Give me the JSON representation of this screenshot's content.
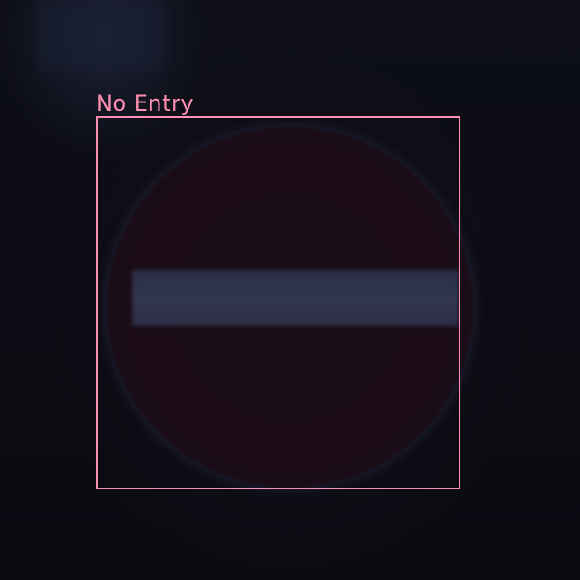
{
  "detection": {
    "label": "No Entry",
    "box_color": "#ff8fb0"
  },
  "scene": {
    "sign_icon": "no-entry-sign"
  }
}
